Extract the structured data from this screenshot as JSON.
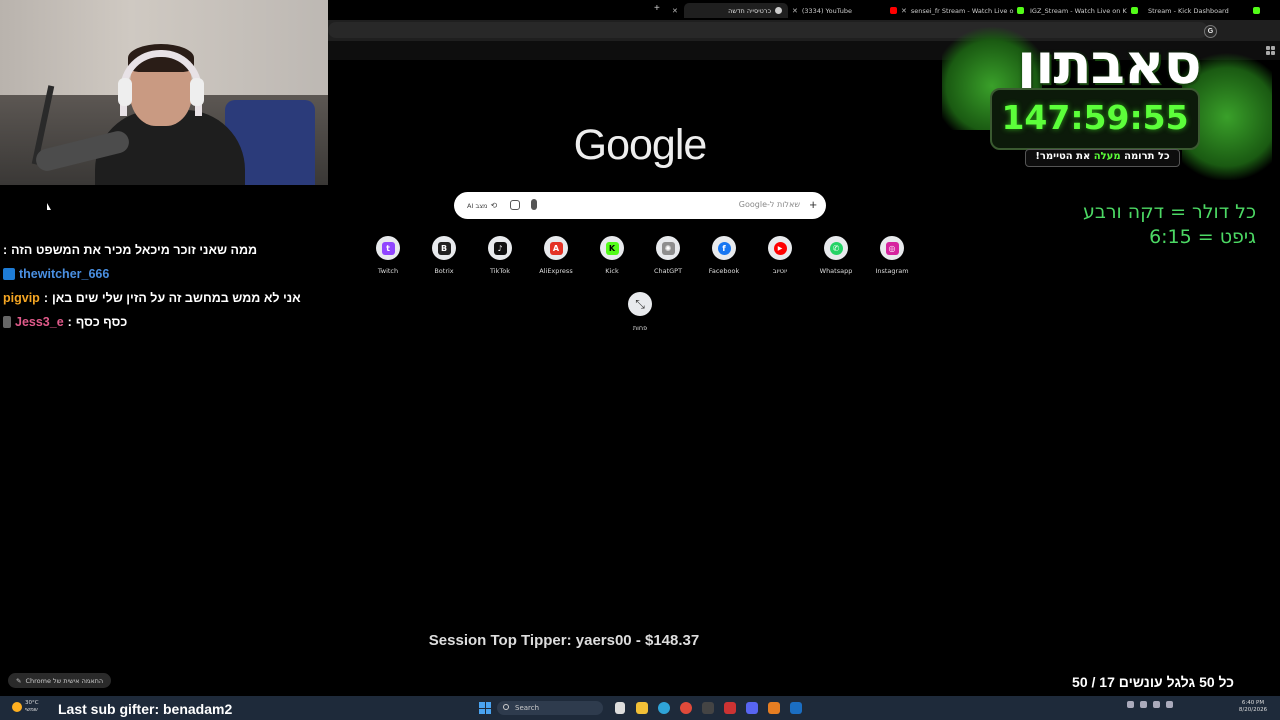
{
  "browser": {
    "tabs": [
      {
        "label": "כרטיסייה חדשה",
        "icon": "chrome-icon",
        "active": true
      },
      {
        "label": "(3334) YouTube",
        "icon": "youtube-icon",
        "active": false
      },
      {
        "label": "sensei_fr Stream - Watch Live o",
        "icon": "kick-icon",
        "active": false
      },
      {
        "label": "IGZ_Stream - Watch Live on K",
        "icon": "kick-icon",
        "active": false
      },
      {
        "label": "Stream - Kick Dashboard",
        "icon": "kick-icon",
        "active": false
      }
    ],
    "new_tab_label": "+",
    "profile_initial": "G"
  },
  "chat": {
    "messages": [
      {
        "user": "thewitcher_666",
        "user_color": "#4a90e2",
        "text": "ממה שאני זוכר מיכאל מכיר את המשפט הזה"
      },
      {
        "user": "pigvip",
        "user_color": "#f5a623",
        "text": "אני לא ממש במחשב זה על הזין שלי שים באן"
      },
      {
        "user": "Jess3_e",
        "user_color": "#e05a8a",
        "text": "כסף כסף"
      }
    ],
    "separator": ":"
  },
  "google": {
    "logo_text": "Google",
    "search_placeholder": "שאלות ל-Google",
    "ai_mode_label": "AI מצב",
    "add_label": "+",
    "shortcuts": [
      {
        "label": "Twitch",
        "icon": "twitch-icon",
        "color": "#9146ff",
        "glyph": "t"
      },
      {
        "label": "Botrix",
        "icon": "botrix-icon",
        "color": "#222222",
        "glyph": "B"
      },
      {
        "label": "TikTok",
        "icon": "tiktok-icon",
        "color": "#111111",
        "glyph": "♪"
      },
      {
        "label": "AliExpress",
        "icon": "aliexpress-icon",
        "color": "#e43225",
        "glyph": "A"
      },
      {
        "label": "Kick",
        "icon": "kick-icon",
        "color": "#53fc18",
        "glyph": "K"
      },
      {
        "label": "ChatGPT",
        "icon": "chatgpt-icon",
        "color": "#8e8e8e",
        "glyph": "✺"
      },
      {
        "label": "Facebook",
        "icon": "facebook-icon",
        "color": "#1877f2",
        "glyph": "f"
      },
      {
        "label": "יוטיוב",
        "icon": "youtube-icon",
        "color": "#ff0000",
        "glyph": "▶"
      },
      {
        "label": "Whatsapp",
        "icon": "whatsapp-icon",
        "color": "#25d366",
        "glyph": "✆"
      },
      {
        "label": "Instagram",
        "icon": "instagram-icon",
        "color": "#d6249f",
        "glyph": "◎"
      }
    ],
    "more_label": "פחות",
    "customize_label": "התאמה אישית של Chrome"
  },
  "overlay": {
    "logo_title": "סאבתון",
    "timer": "147:59:55",
    "donate_note_prefix": "כל תרומה ",
    "donate_note_highlight": "מעלה",
    "donate_note_suffix": " את הטיימר!",
    "rate_line1": "כל דולר = דקה ורבע",
    "rate_line2": "גיפט = 6:15",
    "top_tipper": "Session Top Tipper: yaers00 - $148.37",
    "punish": "כל 50 גלגל עונשים 17 / 50",
    "last_sub": "Last sub gifter: benadam2"
  },
  "taskbar": {
    "weather_temp": "30°C",
    "weather_desc": "שמשי",
    "search_label": "Search",
    "time": "6:40 PM",
    "date": "8/20/2026"
  }
}
